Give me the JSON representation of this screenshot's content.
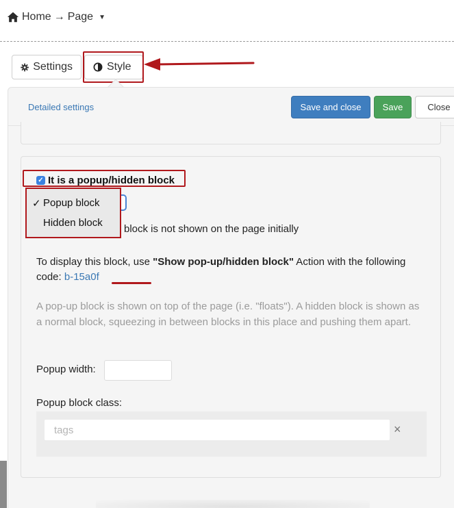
{
  "breadcrumb": {
    "home": "Home",
    "arrow": "→",
    "page": "Page"
  },
  "tabs": {
    "settings": "Settings",
    "style": "Style"
  },
  "header": {
    "detailed_link": "Detailed settings",
    "save_close": "Save and close",
    "save": "Save",
    "close": "Close"
  },
  "popup": {
    "checkbox_label": "It is a popup/hidden block",
    "options": [
      {
        "label": "Popup block",
        "selected": true
      },
      {
        "label": "Hidden block",
        "selected": false
      }
    ],
    "note": "block is not shown on the page initially",
    "display_prefix": "To display this block, use ",
    "display_action": "\"Show pop-up/hidden block\"",
    "display_middle": " Action with the following code: ",
    "display_code": "b-15a0f",
    "description": "A pop-up block is shown on top of the page (i.e. \"floats\"). A hidden block is shown as a normal block, squeezing in between blocks in this place and pushing them apart.",
    "width_label": "Popup width:",
    "width_value": "",
    "class_label": "Popup block class:",
    "tags_placeholder": "tags",
    "clear_symbol": "×"
  },
  "colors": {
    "highlight": "#b0181c",
    "primary_button": "#3f7ebf",
    "success_button": "#4aa25a",
    "link": "#3a78b4",
    "muted_text": "#9b9b9b"
  },
  "icons": {
    "home": "home-icon",
    "settings": "gear-icon",
    "style": "contrast-icon",
    "dropdown_caret": "caret-down-icon",
    "clear": "close-icon"
  }
}
